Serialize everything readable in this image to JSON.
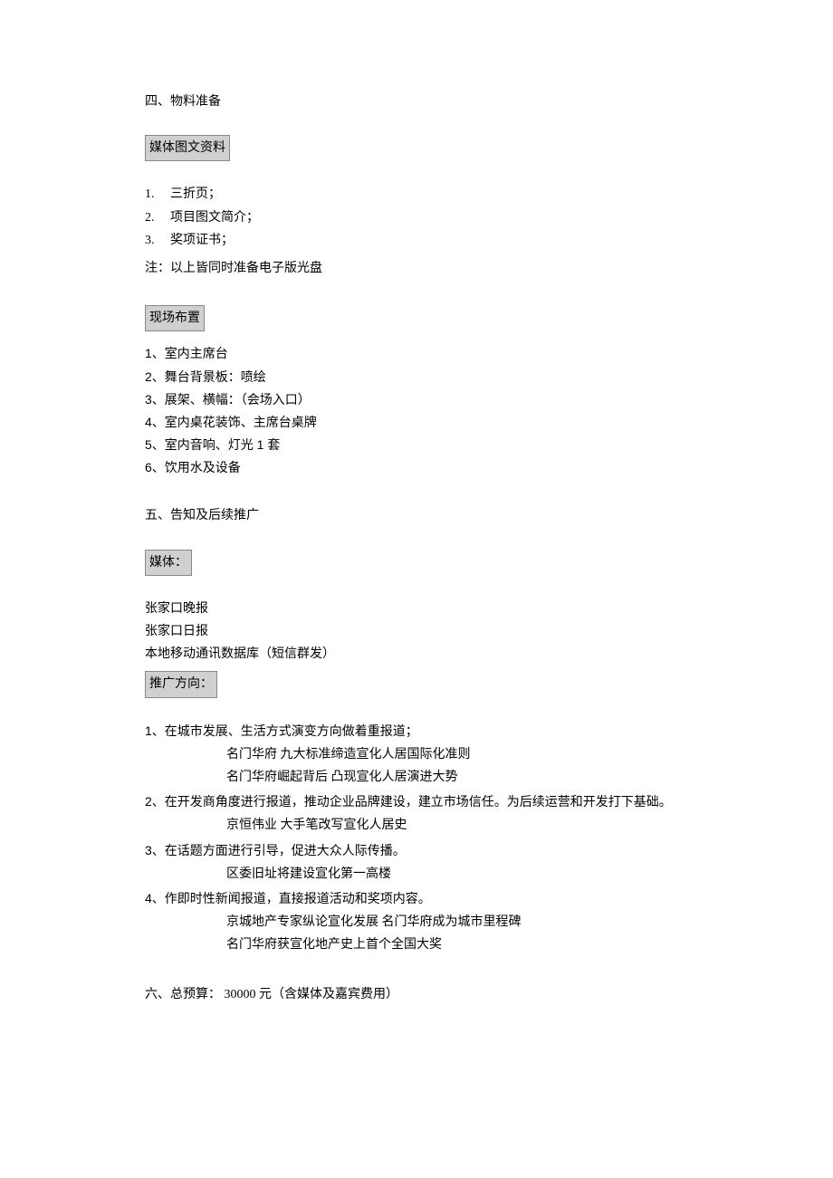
{
  "section4": {
    "title": "四、物料准备",
    "media_label": "媒体图文资料",
    "media_items": [
      {
        "num": "1.",
        "text": "三折页；"
      },
      {
        "num": "2.",
        "text": "项目图文简介；"
      },
      {
        "num": "3.",
        "text": "奖项证书；"
      }
    ],
    "media_note": "注：以上皆同时准备电子版光盘",
    "venue_label": "现场布置",
    "venue_items": [
      "1、室内主席台",
      "2、舞台背景板：喷绘",
      "3、展架、横幅：（会场入口）",
      "4、室内桌花装饰、主席台桌牌",
      "5、室内音响、灯光    1 套",
      "6、饮用水及设备"
    ]
  },
  "section5": {
    "title": "五、告知及后续推广",
    "media_label": "媒体：",
    "media_channels": [
      "张家口晚报",
      "张家口日报",
      "本地移动通讯数据库（短信群发）"
    ],
    "promo_label": "推广方向：",
    "promo_items": [
      {
        "num": "1",
        "head": "、在城市发展、生活方式演变方向做着重报道；",
        "lines": [
          "名门华府    九大标准缔造宣化人居国际化准则",
          "名门华府崛起背后     凸现宣化人居演进大势"
        ]
      },
      {
        "num": "2",
        "head": "、在开发商角度进行报道，推动企业品牌建设，建立市场信任。为后续运营和开发打下基础。",
        "lines": [
          "京恒伟业    大手笔改写宣化人居史"
        ]
      },
      {
        "num": "3",
        "head": "、在话题方面进行引导，促进大众人际传播。",
        "lines": [
          "区委旧址将建设宣化第一高楼"
        ]
      },
      {
        "num": "4",
        "head": "、作即时性新闻报道，直接报道活动和奖项内容。",
        "lines": [
          "京城地产专家纵论宣化发展         名门华府成为城市里程碑",
          "名门华府获宣化地产史上首个全国大奖"
        ]
      }
    ]
  },
  "section6": {
    "title": "六、总预算：   30000 元（含媒体及嘉宾费用）"
  }
}
